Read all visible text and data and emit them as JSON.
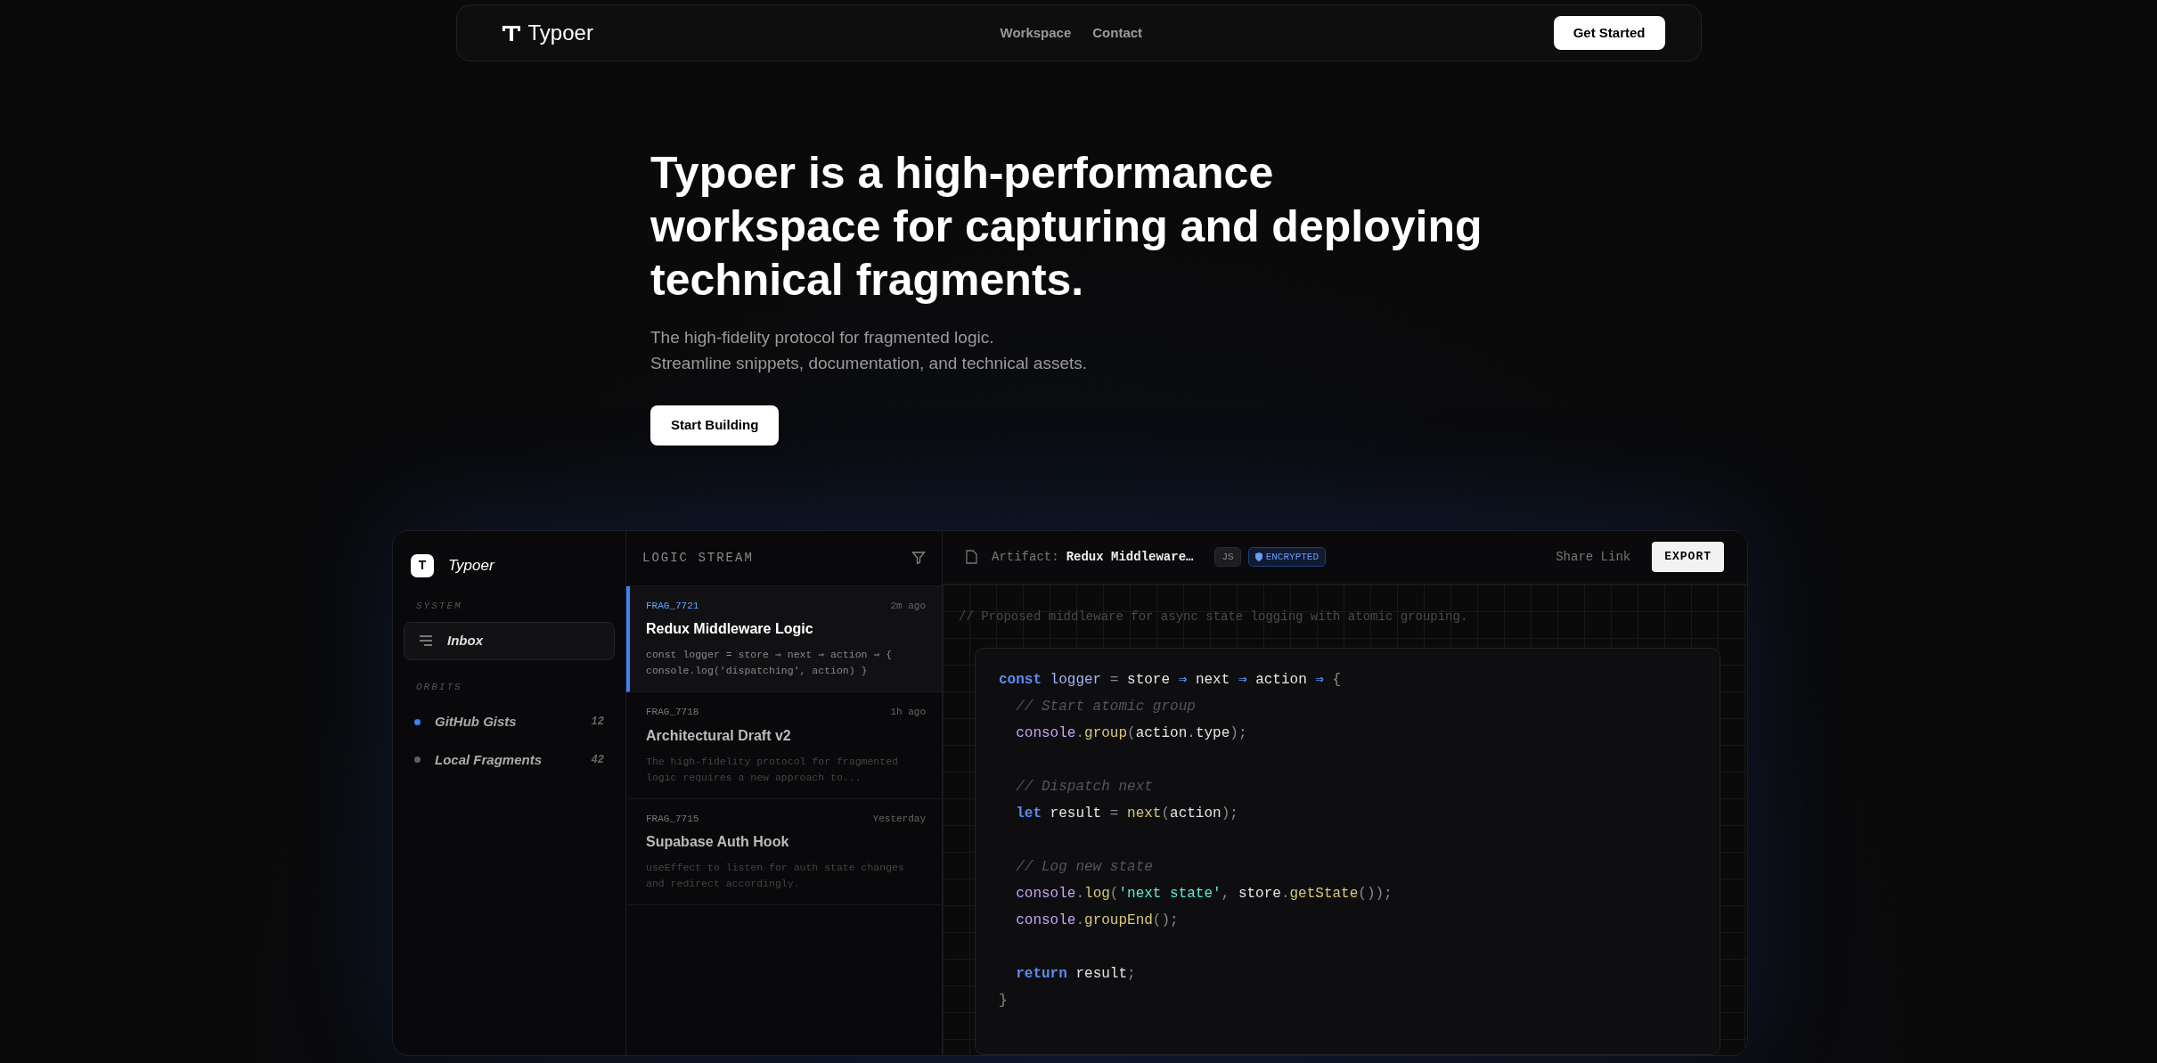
{
  "navbar": {
    "brand": "Typoer",
    "links": [
      {
        "label": "Workspace"
      },
      {
        "label": "Contact"
      }
    ],
    "cta": "Get Started"
  },
  "hero": {
    "title": "Typoer is a high-performance workspace for capturing and deploying technical fragments.",
    "subtitle_lines": [
      "The high-fidelity protocol for fragmented logic.",
      "Streamline snippets, documentation, and technical assets."
    ],
    "button": "Start Building"
  },
  "app": {
    "sidebar": {
      "logo_letter": "T",
      "brand": "Typoer",
      "sections": [
        {
          "title": "SYSTEM",
          "kind": "nav",
          "items": [
            {
              "label": "Inbox",
              "selected": true
            }
          ]
        },
        {
          "title": "ORBITS",
          "kind": "orbit",
          "items": [
            {
              "label": "GitHub Gists",
              "count": "12",
              "color": "#3b82f6"
            },
            {
              "label": "Local Fragments",
              "count": "42",
              "color": "#5b5f66"
            }
          ]
        }
      ]
    },
    "stream": {
      "title": "LOGIC STREAM",
      "items": [
        {
          "id": "FRAG_7721",
          "time": "2m ago",
          "title": "Redux Middleware Logic",
          "preview": "const logger = store ⇒ next ⇒ action ⇒ { console.log('dispatching', action) }",
          "selected": true
        },
        {
          "id": "FRAG_7718",
          "time": "1h ago",
          "title": "Architectural Draft v2",
          "preview": "The high-fidelity protocol for fragmented logic requires a new approach to...",
          "selected": false
        },
        {
          "id": "FRAG_7715",
          "time": "Yesterday",
          "title": "Supabase Auth Hook",
          "preview": "useEffect to listen for auth state changes and redirect accordingly.",
          "selected": false
        }
      ]
    },
    "editor": {
      "artifact_label": "Artifact:",
      "artifact_name": "Redux Middleware…",
      "badges": [
        {
          "label": "JS",
          "kind": "plain"
        },
        {
          "label": "ENCRYPTED",
          "kind": "secure"
        }
      ],
      "share": "Share Link",
      "export": "EXPORT",
      "comment": "// Proposed middleware for async state logging with atomic grouping.",
      "blocks": [
        [
          {
            "tokens": [
              {
                "text": "const ",
                "kind": "kw"
              },
              {
                "text": "logger",
                "kind": "var"
              },
              {
                "text": " = ",
                "kind": "punct"
              },
              {
                "text": "store ",
                "kind": "plain"
              },
              {
                "text": "⇒",
                "kind": "kw"
              },
              {
                "text": " next ",
                "kind": "plain"
              },
              {
                "text": "⇒",
                "kind": "kw"
              },
              {
                "text": " action ",
                "kind": "plain"
              },
              {
                "text": "⇒",
                "kind": "kw"
              },
              {
                "text": " {",
                "kind": "punct"
              }
            ]
          },
          {
            "tokens": [
              {
                "text": "  // Start atomic group",
                "kind": "comment"
              }
            ]
          },
          {
            "tokens": [
              {
                "text": "  console",
                "kind": "obj"
              },
              {
                "text": ".",
                "kind": "punct"
              },
              {
                "text": "group",
                "kind": "fn"
              },
              {
                "text": "(",
                "kind": "punct"
              },
              {
                "text": "action",
                "kind": "plain"
              },
              {
                "text": ".",
                "kind": "punct"
              },
              {
                "text": "type",
                "kind": "plain"
              },
              {
                "text": ");",
                "kind": "punct"
              }
            ]
          }
        ],
        [
          {
            "tokens": [
              {
                "text": "  // Dispatch next",
                "kind": "comment"
              }
            ]
          },
          {
            "tokens": [
              {
                "text": "  let ",
                "kind": "kw"
              },
              {
                "text": "result",
                "kind": "plain"
              },
              {
                "text": " = ",
                "kind": "punct"
              },
              {
                "text": "next",
                "kind": "fn"
              },
              {
                "text": "(",
                "kind": "punct"
              },
              {
                "text": "action",
                "kind": "plain"
              },
              {
                "text": ");",
                "kind": "punct"
              }
            ]
          }
        ],
        [
          {
            "tokens": [
              {
                "text": "  // Log new state",
                "kind": "comment"
              }
            ]
          },
          {
            "tokens": [
              {
                "text": "  console",
                "kind": "obj"
              },
              {
                "text": ".",
                "kind": "punct"
              },
              {
                "text": "log",
                "kind": "fn"
              },
              {
                "text": "(",
                "kind": "punct"
              },
              {
                "text": "'next state'",
                "kind": "str"
              },
              {
                "text": ", ",
                "kind": "punct"
              },
              {
                "text": "store",
                "kind": "plain"
              },
              {
                "text": ".",
                "kind": "punct"
              },
              {
                "text": "getState",
                "kind": "fn"
              },
              {
                "text": "());",
                "kind": "punct"
              }
            ]
          },
          {
            "tokens": [
              {
                "text": "  console",
                "kind": "obj"
              },
              {
                "text": ".",
                "kind": "punct"
              },
              {
                "text": "groupEnd",
                "kind": "fn"
              },
              {
                "text": "();",
                "kind": "punct"
              }
            ]
          }
        ],
        [
          {
            "tokens": [
              {
                "text": "  return ",
                "kind": "kw"
              },
              {
                "text": "result",
                "kind": "plain"
              },
              {
                "text": ";",
                "kind": "punct"
              }
            ]
          },
          {
            "tokens": [
              {
                "text": "}",
                "kind": "punct"
              }
            ]
          }
        ]
      ]
    }
  }
}
